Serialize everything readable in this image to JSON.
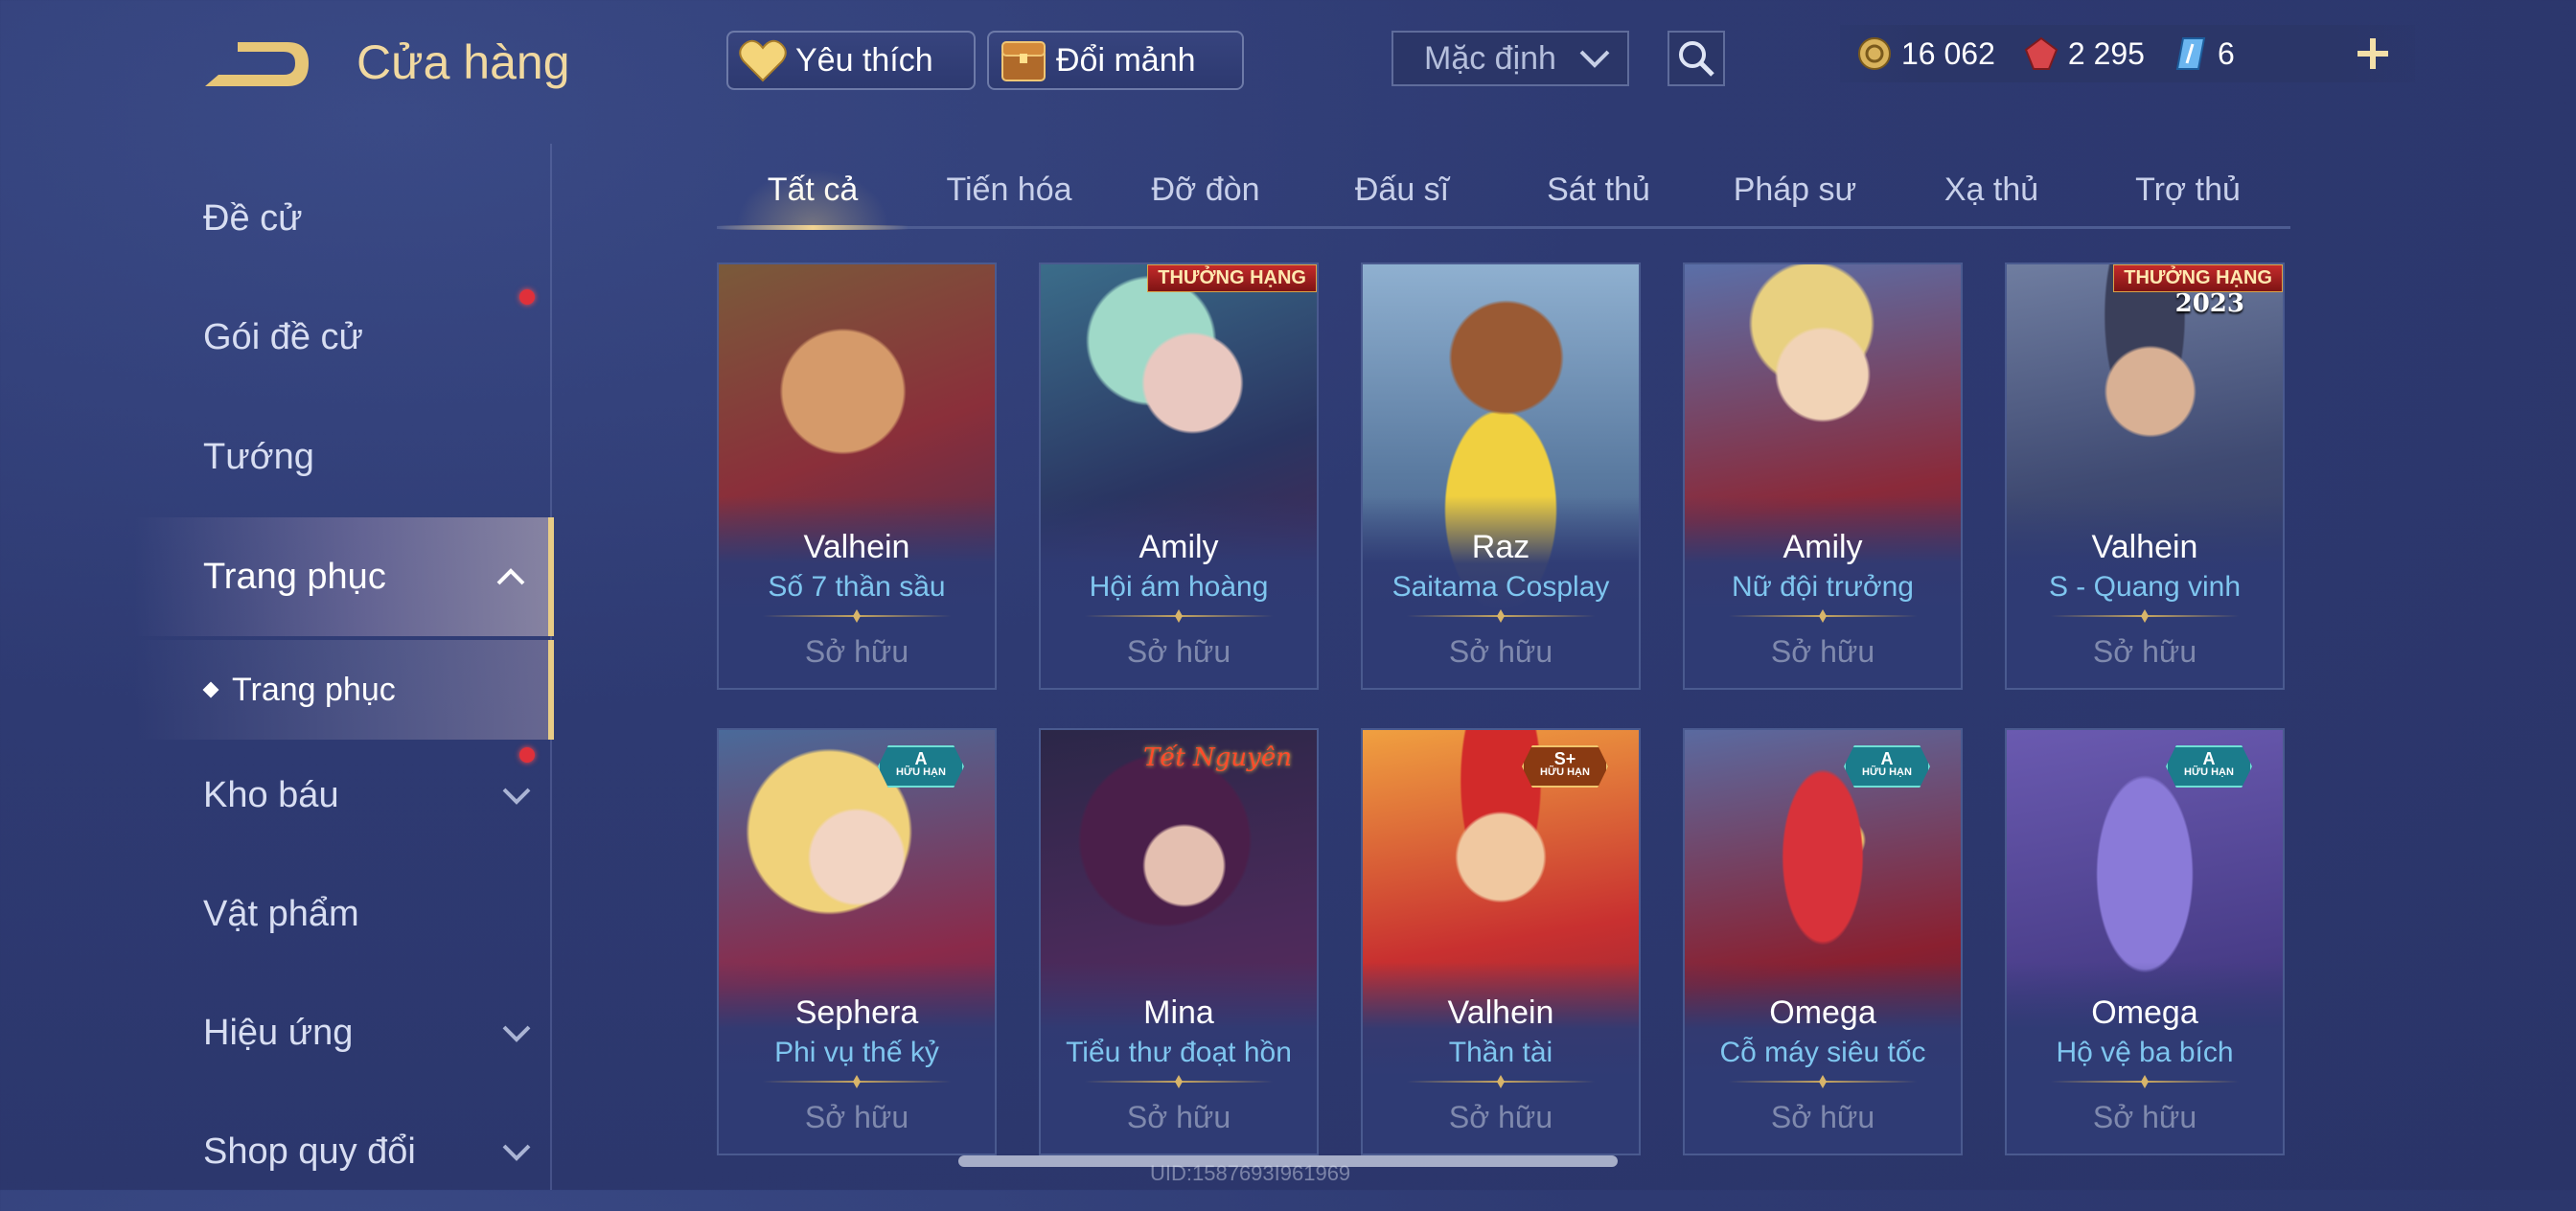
{
  "header": {
    "title": "Cửa hàng",
    "favorites_label": "Yêu thích",
    "exchange_label": "Đổi mảnh",
    "sort_value": "Mặc định",
    "currencies": [
      {
        "name": "gold",
        "value": "16 062"
      },
      {
        "name": "vouchers",
        "value": "2 295"
      },
      {
        "name": "tickets",
        "value": "6"
      }
    ]
  },
  "sidebar": {
    "items": [
      {
        "label": "Đề cử"
      },
      {
        "label": "Gói đề cử"
      },
      {
        "label": "Tướng"
      },
      {
        "label": "Trang phục"
      },
      {
        "label": "Kho báu"
      },
      {
        "label": "Vật phẩm"
      },
      {
        "label": "Hiệu ứng"
      },
      {
        "label": "Shop quy đổi"
      }
    ],
    "sub_item": "Trang phục"
  },
  "tabs": [
    "Tất cả",
    "Tiến hóa",
    "Đỡ đòn",
    "Đấu sĩ",
    "Sát thủ",
    "Pháp sư",
    "Xạ thủ",
    "Trợ thủ"
  ],
  "cards": [
    {
      "hero": "Valhein",
      "skin": "Số 7 thần sầu",
      "status": "Sở hữu"
    },
    {
      "hero": "Amily",
      "skin": "Hội ám hoàng",
      "status": "Sở hữu",
      "badge": "THƯỞNG HẠNG"
    },
    {
      "hero": "Raz",
      "skin": "Saitama Cosplay",
      "status": "Sở hữu"
    },
    {
      "hero": "Amily",
      "skin": "Nữ đội trưởng",
      "status": "Sở hữu"
    },
    {
      "hero": "Valhein",
      "skin": "S - Quang vinh",
      "status": "Sở hữu",
      "badge": "THƯỞNG HẠNG",
      "year": "2023"
    },
    {
      "hero": "Sephera",
      "skin": "Phi vụ thế kỷ",
      "status": "Sở hữu",
      "tier": "A",
      "tier_sub": "HỮU HẠN"
    },
    {
      "hero": "Mina",
      "skin": "Tiểu thư đoạt hồn",
      "status": "Sở hữu",
      "event": "Tết Nguyên"
    },
    {
      "hero": "Valhein",
      "skin": "Thần tài",
      "status": "Sở hữu",
      "tier": "S+",
      "tier_sub": "HỮU HẠN"
    },
    {
      "hero": "Omega",
      "skin": "Cỗ máy siêu tốc",
      "status": "Sở hữu",
      "tier": "A",
      "tier_sub": "HỮU HẠN"
    },
    {
      "hero": "Omega",
      "skin": "Hộ vệ ba bích",
      "status": "Sở hữu",
      "tier": "A",
      "tier_sub": "HỮU HẠN"
    }
  ],
  "footer": {
    "uid": "UID:1587693I961969"
  },
  "colors": {
    "accent_gold": "#e8cc86",
    "skin_text": "#7fc6ef",
    "bg": "#2e3a72",
    "notify_dot": "#e0303a"
  },
  "icons": [
    "back-arrow-icon",
    "heart-icon",
    "chest-icon",
    "chevron-down-icon",
    "search-icon",
    "gold-coin-icon",
    "red-gem-icon",
    "ticket-icon",
    "plus-icon",
    "chevron-up-icon"
  ]
}
